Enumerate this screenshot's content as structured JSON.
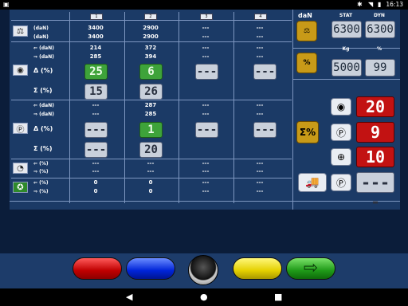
{
  "status": {
    "time": "16:13"
  },
  "columns": [
    "1",
    "2",
    "3",
    "4"
  ],
  "right_panel": {
    "title": "daN",
    "stat_label": "STAT",
    "dyn_label": "DYN",
    "stat_value": "6300",
    "dyn_value": "6300",
    "kg_label": "Kg",
    "pct_label": "%",
    "kg_value": "5000",
    "pct_value": "99",
    "red_values": [
      "20",
      "9",
      "10"
    ],
    "grey_value": "----"
  },
  "rows": {
    "dan1": {
      "unit": "(daN)",
      "values": [
        "3400",
        "2900",
        "---",
        "---"
      ]
    },
    "dan2": {
      "unit": "(daN)",
      "values": [
        "3400",
        "2900",
        "---",
        "---"
      ]
    },
    "left_dan": {
      "unit": "(daN)",
      "values": [
        "214",
        "372",
        "---",
        "---"
      ]
    },
    "right_dan": {
      "unit": "(daN)",
      "values": [
        "285",
        "394",
        "---",
        "---"
      ]
    },
    "delta1": {
      "label": "Δ (%)",
      "values": [
        "25",
        "6",
        "---",
        "---"
      ]
    },
    "sigma1": {
      "label": "Σ (%)",
      "values": [
        "15",
        "26",
        "---",
        "---"
      ]
    },
    "left_dan2": {
      "unit": "(daN)",
      "values": [
        "---",
        "287",
        "---",
        "---"
      ]
    },
    "right_dan2": {
      "unit": "(daN)",
      "values": [
        "---",
        "285",
        "---",
        "---"
      ]
    },
    "delta2": {
      "label": "Δ (%)",
      "values": [
        "---",
        "1",
        "---",
        "---"
      ]
    },
    "sigma2": {
      "label": "Σ (%)",
      "values": [
        "---",
        "20",
        "---",
        "---"
      ]
    },
    "left_pct1": {
      "unit": "(%)",
      "values": [
        "---",
        "---",
        "---",
        "---"
      ]
    },
    "right_pct1": {
      "unit": "(%)",
      "values": [
        "---",
        "---",
        "---",
        "---"
      ]
    },
    "left_pct2": {
      "unit": "(%)",
      "values": [
        "0",
        "0",
        "---",
        "---"
      ]
    },
    "right_pct2": {
      "unit": "(%)",
      "values": [
        "0",
        "0",
        "---",
        "---"
      ]
    }
  }
}
